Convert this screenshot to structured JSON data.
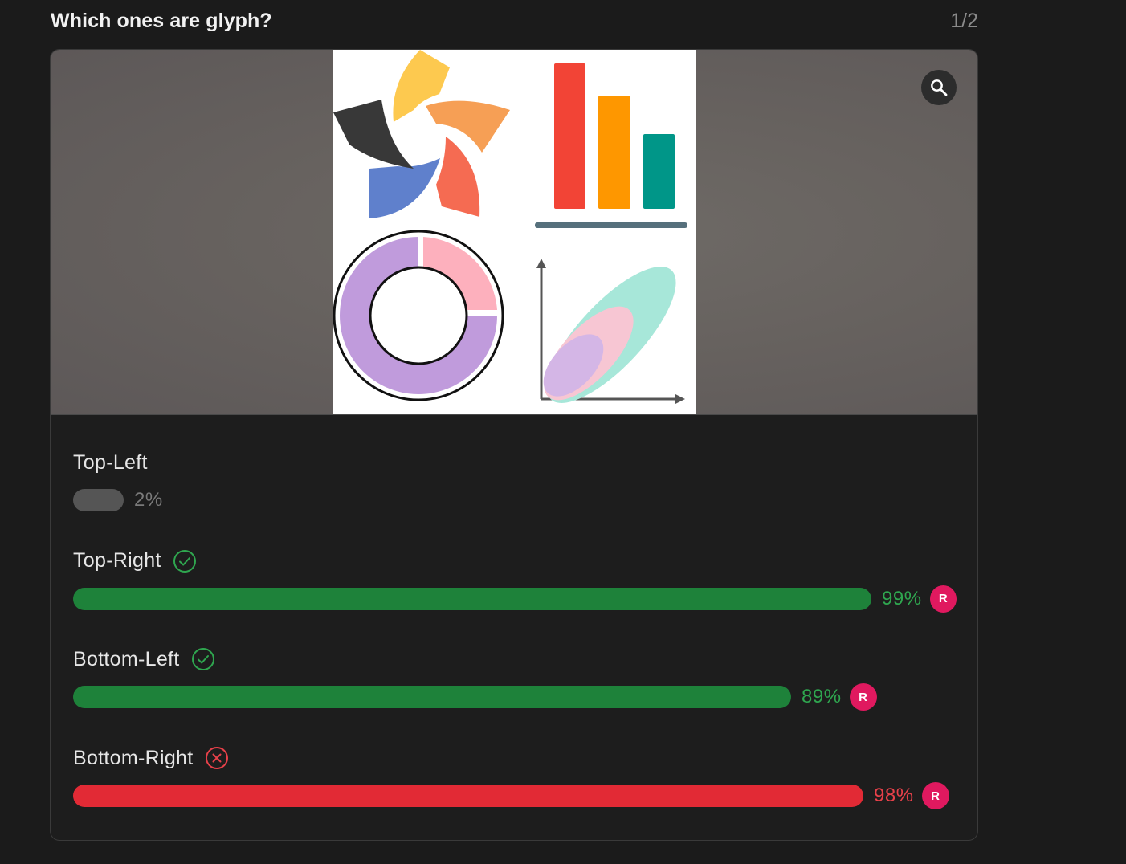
{
  "question": {
    "title": "Which ones are glyph?",
    "counter": "1/2"
  },
  "image": {
    "zoom_icon": "search-icon"
  },
  "options": [
    {
      "label": "Top-Left",
      "percent": 2,
      "percent_label": "2%",
      "status": "none",
      "bar_color": "#555555",
      "text_color": "#7a7a7a",
      "avatar": ""
    },
    {
      "label": "Top-Right",
      "percent": 99,
      "percent_label": "99%",
      "status": "correct",
      "bar_color": "#1e823a",
      "text_color": "#2fa64f",
      "avatar": "R"
    },
    {
      "label": "Bottom-Left",
      "percent": 89,
      "percent_label": "89%",
      "status": "correct",
      "bar_color": "#1e823a",
      "text_color": "#2fa64f",
      "avatar": "R"
    },
    {
      "label": "Bottom-Right",
      "percent": 98,
      "percent_label": "98%",
      "status": "wrong",
      "bar_color": "#e22a35",
      "text_color": "#e8414a",
      "avatar": "R"
    }
  ],
  "colors": {
    "correct_icon": "#2fa64f",
    "wrong_icon": "#e8414a",
    "avatar_bg": "#e0195f"
  }
}
